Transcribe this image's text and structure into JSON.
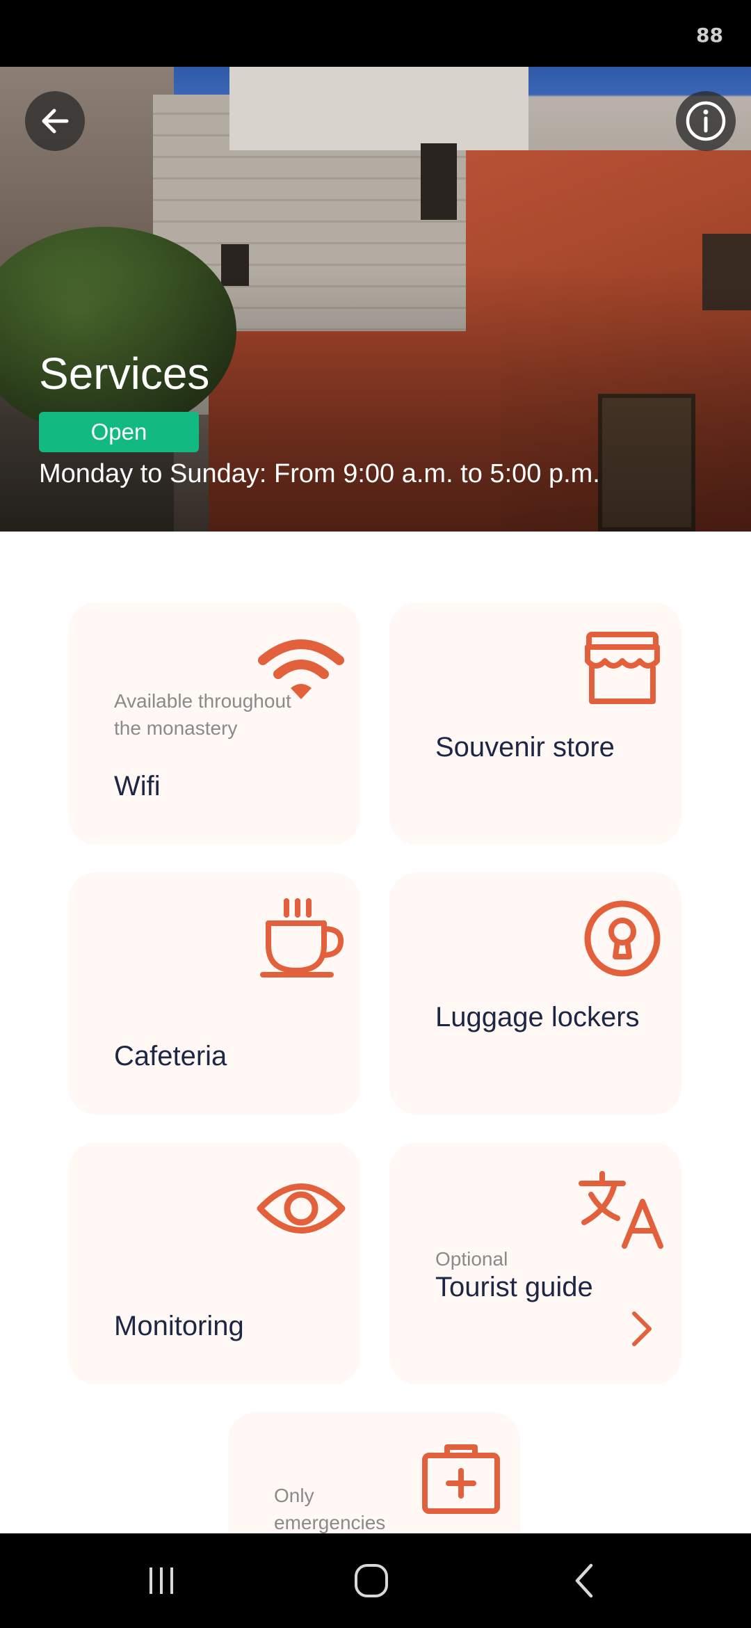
{
  "status_bar": {
    "battery": "88"
  },
  "header": {
    "title": "Services",
    "status_badge": "Open",
    "hours": "Monday to Sunday: From 9:00 a.m. to 5:00 p.m."
  },
  "services": [
    {
      "sub": "Available throughout the monastery",
      "label": "Wifi",
      "icon": "wifi-icon"
    },
    {
      "sub": "",
      "label": "Souvenir store",
      "icon": "store-icon"
    },
    {
      "sub": "",
      "label": "Cafeteria",
      "icon": "coffee-cup-icon"
    },
    {
      "sub": "",
      "label": "Luggage lockers",
      "icon": "lock-icon"
    },
    {
      "sub": "",
      "label": "Monitoring",
      "icon": "eye-icon"
    },
    {
      "sub": "Optional",
      "label": "Tourist guide",
      "icon": "translate-icon"
    },
    {
      "sub": "Only emergencies",
      "label": "",
      "icon": "first-aid-kit-icon"
    }
  ],
  "colors": {
    "accent": "#e2603b",
    "badge": "#12b981",
    "card_bg": "#fff8f4",
    "text_dark": "#1d2645"
  }
}
